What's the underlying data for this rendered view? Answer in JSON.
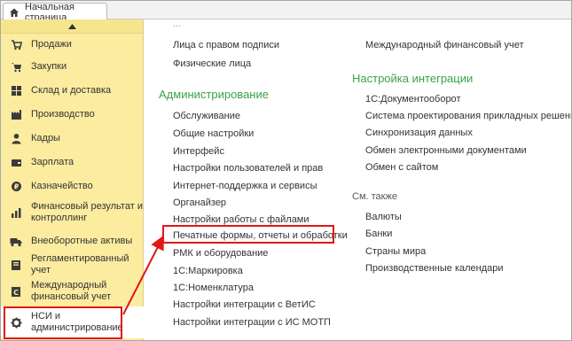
{
  "tab": {
    "home_label": "Начальная страница"
  },
  "sidebar": {
    "items": [
      {
        "label": "Продажи",
        "icon": "cart-icon"
      },
      {
        "label": "Закупки",
        "icon": "shopping-cart-icon"
      },
      {
        "label": "Склад и доставка",
        "icon": "warehouse-icon"
      },
      {
        "label": "Производство",
        "icon": "factory-icon"
      },
      {
        "label": "Кадры",
        "icon": "person-icon"
      },
      {
        "label": "Зарплата",
        "icon": "wallet-icon"
      },
      {
        "label": "Казначейство",
        "icon": "coin-icon"
      },
      {
        "label": "Финансовый результат и контроллинг",
        "icon": "chart-icon"
      },
      {
        "label": "Внеоборотные активы",
        "icon": "truck-icon"
      },
      {
        "label": "Регламентированный учет",
        "icon": "ledger-icon"
      },
      {
        "label": "Международный финансовый учет",
        "icon": "international-ledger-icon"
      },
      {
        "label": "НСИ и администрирование",
        "icon": "gear-icon"
      }
    ]
  },
  "main": {
    "left_col": {
      "partial_top": "...",
      "top_links": [
        "Лица с правом подписи",
        "Физические лица"
      ],
      "admin_title": "Администрирование",
      "admin_links": [
        "Обслуживание",
        "Общие настройки",
        "Интерфейс",
        "Настройки пользователей и прав",
        "Интернет-поддержка и сервисы",
        "Органайзер",
        "Настройки работы с файлами",
        "Печатные формы, отчеты и обработки",
        "РМК и оборудование",
        "1С:Маркировка",
        "1С:Номенклатура",
        "Настройки интеграции с ВетИС",
        "Настройки интеграции с ИС МОТП"
      ]
    },
    "right_col": {
      "top_link": "Международный финансовый учет",
      "integration_title": "Настройка интеграции",
      "integration_links": [
        "1С:Документооборот",
        "Система проектирования прикладных решений",
        "Синхронизация данных",
        "Обмен электронными документами",
        "Обмен с сайтом"
      ],
      "see_also_title": "См. также",
      "see_also_links": [
        "Валюты",
        "Банки",
        "Страны мира",
        "Производственные календари"
      ]
    }
  },
  "colors": {
    "sidebar_bg": "#fbeca0",
    "section_title": "#3aa24a",
    "highlight": "#e11717"
  }
}
